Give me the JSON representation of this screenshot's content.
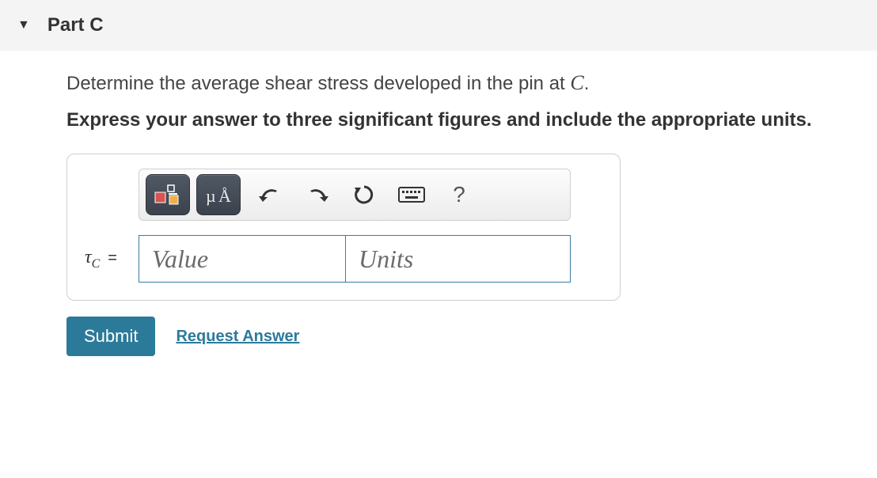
{
  "header": {
    "title": "Part C"
  },
  "prompt": {
    "text_before": "Determine the average shear stress developed in the pin at ",
    "variable": "C",
    "text_after": "."
  },
  "instructions": "Express your answer to three significant figures and include the appropriate units.",
  "toolbar": {
    "templates_label": "templates",
    "symbols_label": "µÅ",
    "undo_label": "undo",
    "redo_label": "redo",
    "reset_label": "reset",
    "keyboard_label": "keyboard",
    "help_label": "?"
  },
  "answer": {
    "variable_html": "τ",
    "subscript": "C",
    "equals": "=",
    "value_placeholder": "Value",
    "units_placeholder": "Units",
    "value": "",
    "units": ""
  },
  "actions": {
    "submit": "Submit",
    "request": "Request Answer"
  }
}
